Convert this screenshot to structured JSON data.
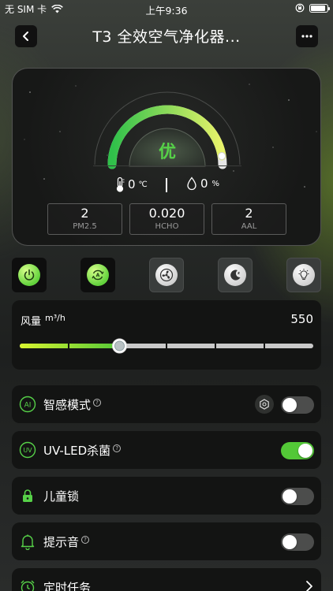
{
  "status_bar": {
    "carrier": "无 SIM 卡",
    "time": "上午9:36"
  },
  "header": {
    "title": "T3 全效空气净化器..."
  },
  "gauge": {
    "quality_label": "优",
    "level_fraction": 0.95,
    "gradient_start": "#2fc04a",
    "gradient_end": "#e8f36a"
  },
  "environment": {
    "temperature": "0",
    "temperature_unit": "℃",
    "humidity": "0",
    "humidity_unit": "%"
  },
  "metrics": [
    {
      "value": "2",
      "label": "PM2.5"
    },
    {
      "value": "0.020",
      "label": "HCHO"
    },
    {
      "value": "2",
      "label": "AAL"
    }
  ],
  "modes": [
    {
      "name": "power",
      "active": true
    },
    {
      "name": "auto",
      "active": true
    },
    {
      "name": "fan",
      "active": false
    },
    {
      "name": "sleep",
      "active": false
    },
    {
      "name": "light",
      "active": false
    }
  ],
  "fan": {
    "label": "风量",
    "unit": "m³/h",
    "value": "550",
    "level_fraction": 0.34,
    "segments": 6,
    "colors": {
      "start": "#d9f530",
      "end": "#53c837",
      "track": "#c9c9c9"
    }
  },
  "settings": [
    {
      "label": "智感模式",
      "icon": "ai-icon",
      "has_help": true,
      "toggle": false
    },
    {
      "label": "UV-LED杀菌",
      "icon": "uv-icon",
      "has_help": true,
      "toggle": true
    },
    {
      "label": "儿童锁",
      "icon": "lock-icon",
      "has_help": false,
      "toggle": false
    },
    {
      "label": "提示音",
      "icon": "bell-icon",
      "has_help": true,
      "toggle": false
    },
    {
      "label": "定时任务",
      "icon": "alarm-clock-icon",
      "has_help": false
    }
  ],
  "colors": {
    "accent_green": "#56d148",
    "card_bg": "#131413"
  }
}
